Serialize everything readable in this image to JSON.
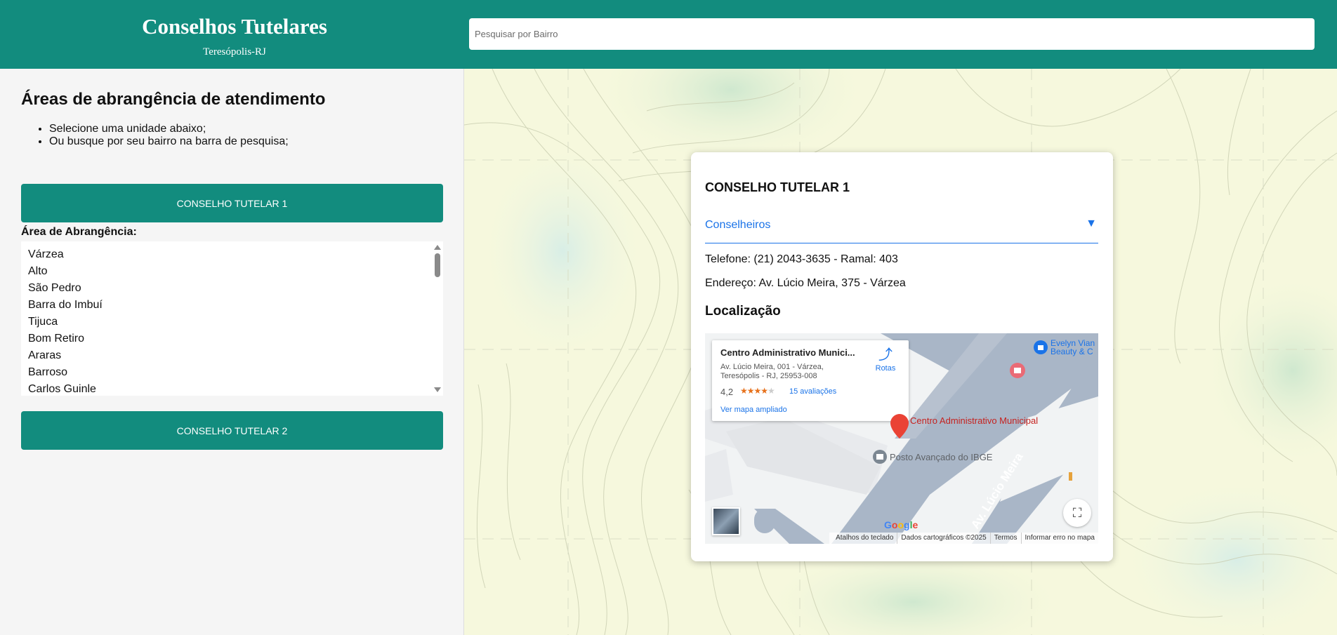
{
  "header": {
    "title": "Conselhos Tutelares",
    "subtitle": "Teresópolis-RJ",
    "search_placeholder": "Pesquisar por Bairro"
  },
  "sidebar": {
    "heading": "Áreas de abrangência de atendimento",
    "instructions": [
      "Selecione uma unidade abaixo;",
      "Ou busque por seu bairro na barra de pesquisa;"
    ],
    "units": [
      {
        "label": "CONSELHO TUTELAR 1"
      },
      {
        "label": "CONSELHO TUTELAR 2"
      }
    ],
    "area_label": "Área de Abrangência:",
    "area_items": [
      "Várzea",
      "Alto",
      "São Pedro",
      "Barra do Imbuí",
      "Tijuca",
      "Bom Retiro",
      "Araras",
      "Barroso",
      "Carlos Guinle"
    ]
  },
  "card": {
    "title": "CONSELHO TUTELAR 1",
    "accordion_label": "Conselheiros",
    "accordion_icon": "▼",
    "phone": "Telefone: (21) 2043-3635 - Ramal: 403",
    "address": "Endereço: Av. Lúcio Meira, 375 - Várzea",
    "location_heading": "Localização",
    "map": {
      "place_title": "Centro Administrativo Munici...",
      "place_address": "Av. Lúcio Meira, 001 - Várzea, Teresópolis - RJ, 25953-008",
      "rating": "4,2",
      "stars": 4.2,
      "reviews": "15 avaliações",
      "view_larger": "Ver mapa ampliado",
      "directions": "Rotas",
      "marker_label": "Centro Administrativo Municipal",
      "poi_ibge": "Posto Avançado do IBGE",
      "poi_beauty": "Evelyn Vian Beauty & C",
      "road": "Av. Lúcio Meira",
      "google": "Google",
      "attribution": [
        "Atalhos do teclado",
        "Dados cartográficos ©2025",
        "Termos",
        "Informar erro no mapa"
      ]
    }
  },
  "colors": {
    "primary": "#128c7e",
    "link": "#1a73e8",
    "marker": "#ea4335"
  }
}
